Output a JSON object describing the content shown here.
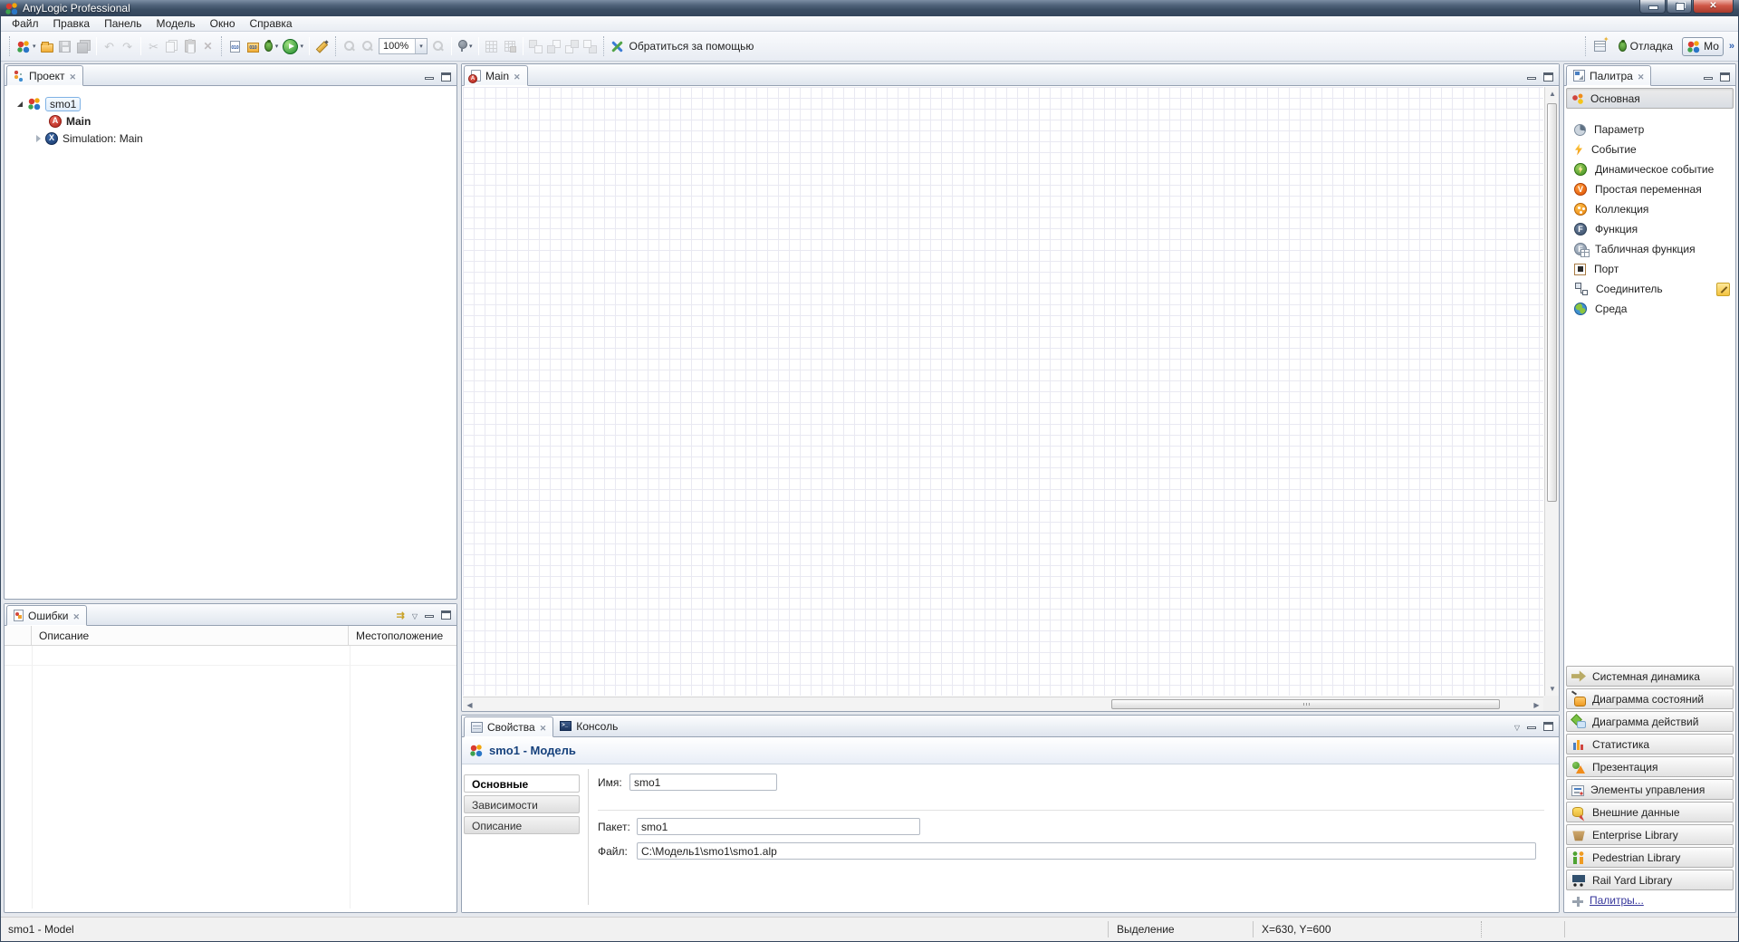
{
  "window": {
    "title": "AnyLogic Professional"
  },
  "menu": {
    "items": [
      "Файл",
      "Правка",
      "Панель",
      "Модель",
      "Окно",
      "Справка"
    ]
  },
  "toolbar": {
    "zoom": "100%",
    "help": "Обратиться за помощью",
    "debug_perspective": "Отладка",
    "model_perspective": "Мо",
    "overflow": "»"
  },
  "project": {
    "tab": "Проект",
    "items": [
      "smo1",
      "Main",
      "Simulation: Main"
    ]
  },
  "errors": {
    "tab": "Ошибки",
    "columns": [
      "Описание",
      "Местоположение"
    ]
  },
  "editor": {
    "tab": "Main"
  },
  "properties": {
    "tabs": [
      "Свойства",
      "Консоль"
    ],
    "title": "smo1 - Модель",
    "nav": [
      "Основные",
      "Зависимости",
      "Описание"
    ],
    "fields": [
      {
        "label": "Имя:",
        "value": "smo1"
      },
      {
        "label": "Пакет:",
        "value": "smo1"
      },
      {
        "label": "Файл:",
        "value": "C:\\Модель1\\smo1\\smo1.alp"
      }
    ]
  },
  "palette": {
    "tab": "Палитра",
    "active_section": "Основная",
    "items": [
      "Параметр",
      "Событие",
      "Динамическое событие",
      "Простая переменная",
      "Коллекция",
      "Функция",
      "Табличная функция",
      "Порт",
      "Соединитель",
      "Среда"
    ],
    "sections": [
      "Системная динамика",
      "Диаграмма состояний",
      "Диаграмма действий",
      "Статистика",
      "Презентация",
      "Элементы управления",
      "Внешние данные",
      "Enterprise Library",
      "Pedestrian Library",
      "Rail Yard Library"
    ],
    "more_link": "Палитры..."
  },
  "status": {
    "model": "smo1 - Model",
    "selection": "Выделение",
    "coords": "X=630, Y=600"
  },
  "colors": {
    "titlebar": "#3e5168",
    "accent_blue": "#16417c",
    "run_green": "#2e9e3f",
    "selection_border": "#7fb2e5"
  }
}
